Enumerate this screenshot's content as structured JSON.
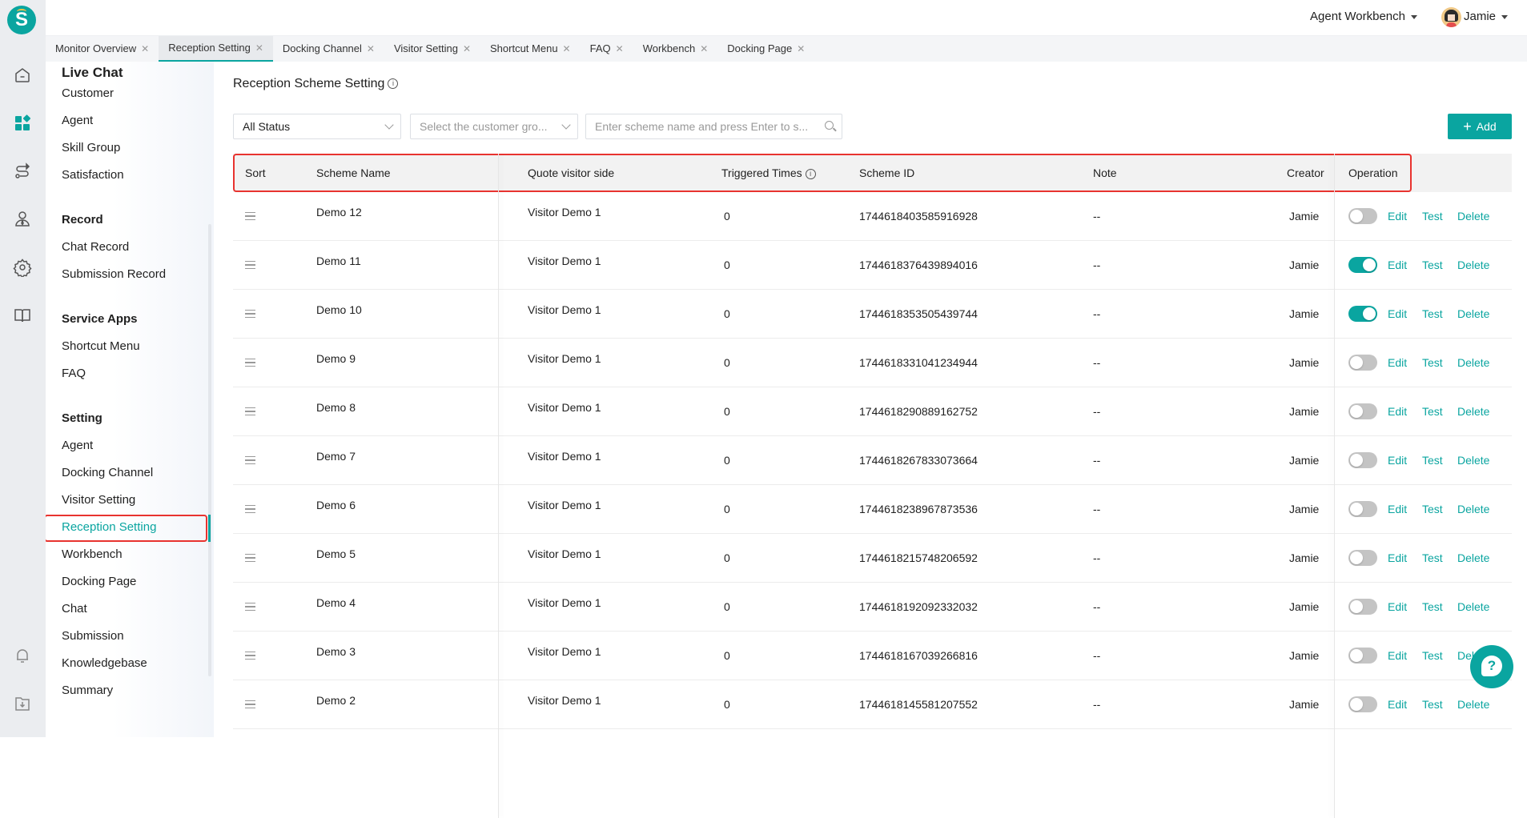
{
  "app": {
    "logo_letter": "S"
  },
  "rail": {
    "icons": [
      "home-icon",
      "apps-icon",
      "route-icon",
      "agent-icon",
      "gear-icon",
      "book-icon",
      "bell-icon",
      "download-icon"
    ],
    "active": "apps-icon"
  },
  "topbar": {
    "workspace": "Agent Workbench",
    "user": "Jamie"
  },
  "tabs": [
    {
      "label": "Monitor Overview",
      "active": false
    },
    {
      "label": "Reception Setting",
      "active": true
    },
    {
      "label": "Docking Channel",
      "active": false
    },
    {
      "label": "Visitor Setting",
      "active": false
    },
    {
      "label": "Shortcut Menu",
      "active": false
    },
    {
      "label": "FAQ",
      "active": false
    },
    {
      "label": "Workbench",
      "active": false
    },
    {
      "label": "Docking Page",
      "active": false
    }
  ],
  "sidenav": {
    "title": "Live Chat",
    "sections": [
      {
        "heading": null,
        "items": [
          "Customer",
          "Agent",
          "Skill Group",
          "Satisfaction"
        ]
      },
      {
        "heading": "Record",
        "items": [
          "Chat Record",
          "Submission Record"
        ]
      },
      {
        "heading": "Service Apps",
        "items": [
          "Shortcut Menu",
          "FAQ"
        ]
      },
      {
        "heading": "Setting",
        "items": [
          "Agent",
          "Docking Channel",
          "Visitor Setting",
          "Reception Setting",
          "Workbench",
          "Docking Page",
          "Chat",
          "Submission",
          "Knowledgebase",
          "Summary"
        ]
      }
    ],
    "active_item": "Reception Setting"
  },
  "main": {
    "title": "Reception Scheme Setting",
    "filters": {
      "status_value": "All Status",
      "group_placeholder": "Select the customer gro...",
      "search_placeholder": "Enter scheme name and press Enter to s..."
    },
    "add_label": "Add",
    "table": {
      "columns": [
        "Sort",
        "Scheme Name",
        "Quote visitor side",
        "Triggered Times",
        "Scheme ID",
        "Note",
        "Creator",
        "Operation"
      ],
      "actions": [
        "Edit",
        "Test",
        "Delete"
      ],
      "rows": [
        {
          "name": "Demo 12",
          "quote": "Visitor Demo 1",
          "triggered": "0",
          "id": "1744618403585916928",
          "note": "--",
          "creator": "Jamie",
          "enabled": false
        },
        {
          "name": "Demo 11",
          "quote": "Visitor Demo 1",
          "triggered": "0",
          "id": "1744618376439894016",
          "note": "--",
          "creator": "Jamie",
          "enabled": true
        },
        {
          "name": "Demo 10",
          "quote": "Visitor Demo 1",
          "triggered": "0",
          "id": "1744618353505439744",
          "note": "--",
          "creator": "Jamie",
          "enabled": true
        },
        {
          "name": "Demo 9",
          "quote": "Visitor Demo 1",
          "triggered": "0",
          "id": "1744618331041234944",
          "note": "--",
          "creator": "Jamie",
          "enabled": false
        },
        {
          "name": "Demo 8",
          "quote": "Visitor Demo 1",
          "triggered": "0",
          "id": "1744618290889162752",
          "note": "--",
          "creator": "Jamie",
          "enabled": false
        },
        {
          "name": "Demo 7",
          "quote": "Visitor Demo 1",
          "triggered": "0",
          "id": "1744618267833073664",
          "note": "--",
          "creator": "Jamie",
          "enabled": false
        },
        {
          "name": "Demo 6",
          "quote": "Visitor Demo 1",
          "triggered": "0",
          "id": "1744618238967873536",
          "note": "--",
          "creator": "Jamie",
          "enabled": false
        },
        {
          "name": "Demo 5",
          "quote": "Visitor Demo 1",
          "triggered": "0",
          "id": "1744618215748206592",
          "note": "--",
          "creator": "Jamie",
          "enabled": false
        },
        {
          "name": "Demo 4",
          "quote": "Visitor Demo 1",
          "triggered": "0",
          "id": "1744618192092332032",
          "note": "--",
          "creator": "Jamie",
          "enabled": false
        },
        {
          "name": "Demo 3",
          "quote": "Visitor Demo 1",
          "triggered": "0",
          "id": "1744618167039266816",
          "note": "--",
          "creator": "Jamie",
          "enabled": false
        },
        {
          "name": "Demo 2",
          "quote": "Visitor Demo 1",
          "triggered": "0",
          "id": "1744618145581207552",
          "note": "--",
          "creator": "Jamie",
          "enabled": false
        }
      ]
    }
  },
  "help": {
    "glyph": "?"
  },
  "colors": {
    "accent": "#0aa5a0",
    "highlight": "#e8332f"
  }
}
